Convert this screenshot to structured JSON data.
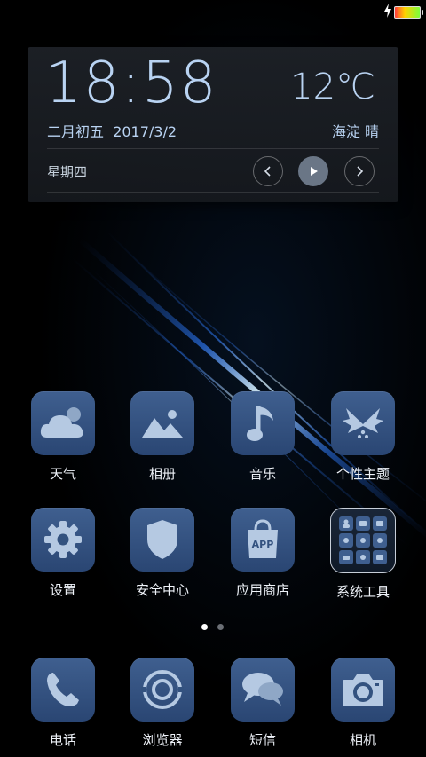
{
  "widget": {
    "time": "18:58",
    "temperature": "12℃",
    "lunar_date": "二月初五",
    "date": "2017/3/2",
    "location_weather": "海淀 晴",
    "weekday": "星期四"
  },
  "pager": {
    "page_count": 2,
    "current_page": 1
  },
  "apps_row1": [
    {
      "label": "天气",
      "icon": "cloud-icon"
    },
    {
      "label": "相册",
      "icon": "gallery-icon"
    },
    {
      "label": "音乐",
      "icon": "music-note-icon"
    },
    {
      "label": "个性主题",
      "icon": "theme-icon"
    }
  ],
  "apps_row2": [
    {
      "label": "设置",
      "icon": "gear-icon"
    },
    {
      "label": "安全中心",
      "icon": "shield-icon"
    },
    {
      "label": "应用商店",
      "icon": "app-store-bag-icon"
    },
    {
      "label": "系统工具",
      "icon": "folder-grid-icon"
    }
  ],
  "dock": [
    {
      "label": "电话",
      "icon": "phone-icon"
    },
    {
      "label": "浏览器",
      "icon": "browser-icon"
    },
    {
      "label": "短信",
      "icon": "message-icon"
    },
    {
      "label": "相机",
      "icon": "camera-icon"
    }
  ],
  "colors": {
    "icon_bg": "#33527f",
    "widget_text": "#b9d3f2"
  }
}
